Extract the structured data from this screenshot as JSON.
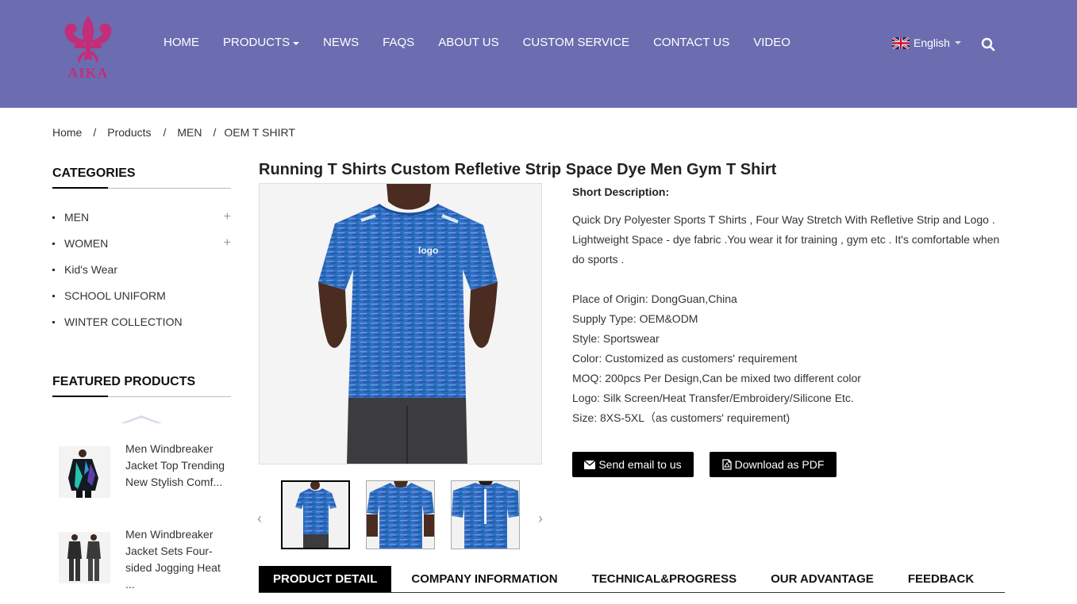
{
  "brand": {
    "logo_text": "AIKA",
    "header_color": "#6b6db0",
    "logo_color": "#c22e7a"
  },
  "nav": {
    "items": [
      "HOME",
      "PRODUCTS",
      "NEWS",
      "FAQS",
      "ABOUT US",
      "CUSTOM SERVICE",
      "CONTACT US",
      "VIDEO"
    ],
    "language": "English"
  },
  "breadcrumb": [
    "Home",
    "Products",
    "MEN",
    "OEM T SHIRT"
  ],
  "sidebar": {
    "categories_title": "CATEGORIES",
    "categories": [
      "MEN",
      "WOMEN",
      "Kid's Wear",
      "SCHOOL UNIFORM",
      "WINTER COLLECTION"
    ],
    "featured_title": "FEATURED PRODUCTS",
    "featured": [
      "Men Windbreaker Jacket Top Trending New Stylish Comf...",
      "Men Windbreaker Jacket Sets Four-sided Jogging Heat ..."
    ]
  },
  "product": {
    "title": "Running T Shirts Custom Refletive Strip Space Dye Men Gym T Shirt",
    "image_logo_text": "logo",
    "short_desc_title": "Short Description:",
    "description": "Quick Dry Polyester Sports T Shirts , Four Way Stretch With Refletive Strip and Logo . Lightweight Space - dye fabric .You wear it for training , gym etc . It's comfortable when do sports .",
    "specs": [
      "Place of Origin: DongGuan,China",
      "Supply Type: OEM&ODM",
      "Style: Sportswear",
      "Color: Customized as customers' requirement",
      "MOQ: 200pcs Per Design,Can be mixed two different color",
      "Logo: Silk Screen/Heat Transfer/Embroidery/Silicone Etc.",
      "Size: 8XS-5XL（as customers' requirement)"
    ],
    "email_button": "Send email to us",
    "pdf_button": "Download as PDF"
  },
  "tabs": [
    "PRODUCT DETAIL",
    "COMPANY INFORMATION",
    "TECHNICAL&PROGRESS",
    "OUR ADVANTAGE",
    "FEEDBACK"
  ]
}
